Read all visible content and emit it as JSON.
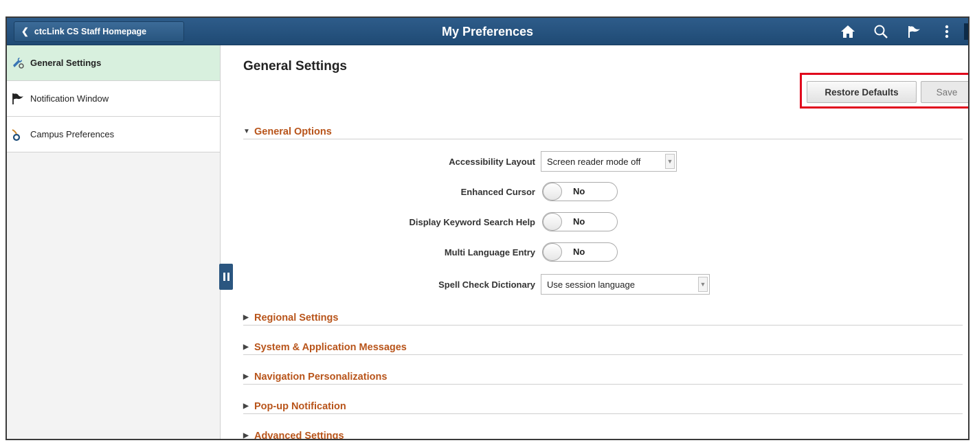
{
  "header": {
    "back_label": "ctcLink CS Staff Homepage",
    "title": "My Preferences",
    "icons": [
      "home-icon",
      "search-icon",
      "flag-icon",
      "more-vertical-icon"
    ]
  },
  "sidebar": {
    "items": [
      {
        "label": "General Settings",
        "icon": "settings-wrench-icon",
        "active": true
      },
      {
        "label": "Notification Window",
        "icon": "flag-icon",
        "active": false
      },
      {
        "label": "Campus Preferences",
        "icon": "campus-icon",
        "active": false
      }
    ]
  },
  "main": {
    "title": "General Settings",
    "buttons": {
      "restore_label": "Restore Defaults",
      "save_label": "Save"
    },
    "general_options": {
      "header": "General Options",
      "expanded": true,
      "accessibility_layout": {
        "label": "Accessibility Layout",
        "value": "Screen reader mode off"
      },
      "enhanced_cursor": {
        "label": "Enhanced Cursor",
        "value": "No"
      },
      "keyword_search_help": {
        "label": "Display Keyword Search Help",
        "value": "No"
      },
      "multi_language_entry": {
        "label": "Multi Language Entry",
        "value": "No"
      },
      "spell_check_dictionary": {
        "label": "Spell Check Dictionary",
        "value": "Use session language"
      }
    },
    "sections": [
      "Regional Settings",
      "System & Application Messages",
      "Navigation Personalizations",
      "Pop-up Notification",
      "Advanced Settings"
    ]
  },
  "colors": {
    "banner": "#2e5c8a",
    "section_header": "#b8541a",
    "active_sidebar": "#d8f0de",
    "highlight_box": "#e0001b"
  }
}
